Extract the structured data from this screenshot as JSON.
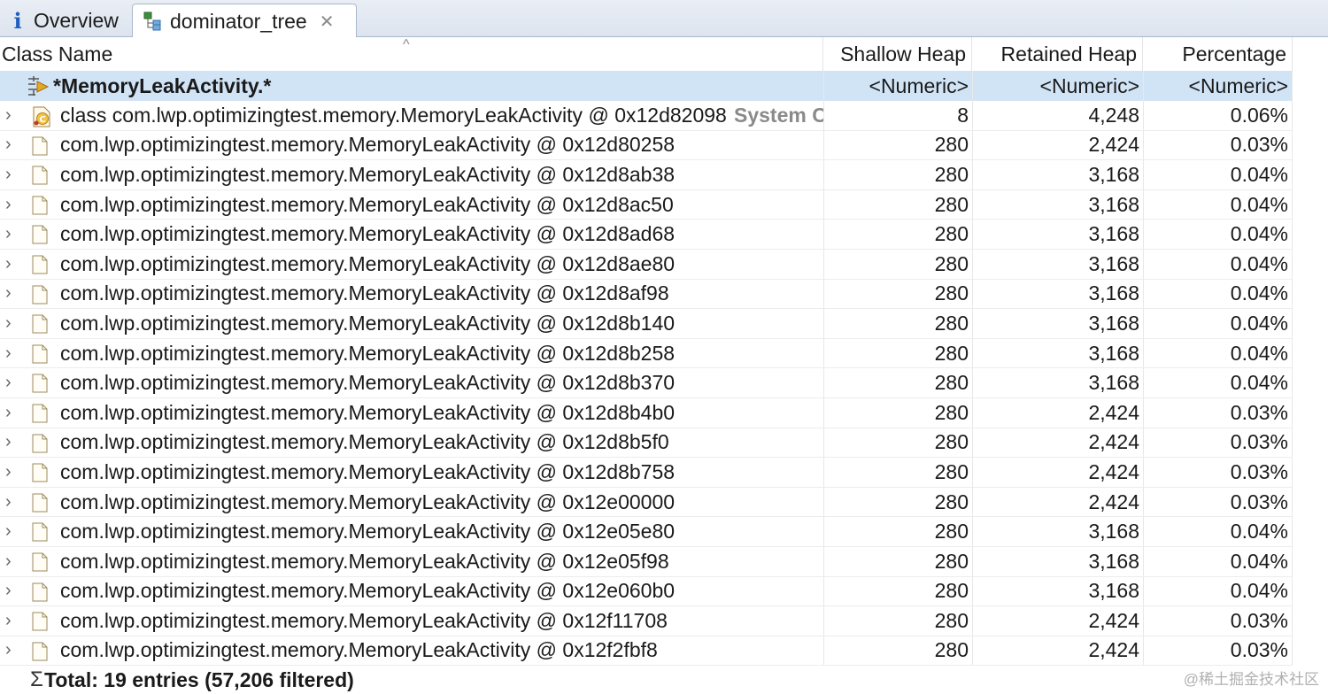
{
  "tabs": [
    {
      "label": "Overview",
      "icon": "info-icon"
    },
    {
      "label": "dominator_tree",
      "icon": "tree-icon",
      "active": true
    }
  ],
  "columns": {
    "name": "Class Name",
    "shallow": "Shallow Heap",
    "retained": "Retained Heap",
    "percentage": "Percentage"
  },
  "filter": {
    "name": "*MemoryLeakActivity.*",
    "shallow": "<Numeric>",
    "retained": "<Numeric>",
    "percentage": "<Numeric>"
  },
  "rows": [
    {
      "name": "class com.lwp.optimizingtest.memory.MemoryLeakActivity @ 0x12d82098",
      "extra": "System Class",
      "shallow": "8",
      "retained": "4,248",
      "pct": "0.06%",
      "icon": "class-icon"
    },
    {
      "name": "com.lwp.optimizingtest.memory.MemoryLeakActivity @ 0x12d80258",
      "shallow": "280",
      "retained": "2,424",
      "pct": "0.03%",
      "icon": "object-icon"
    },
    {
      "name": "com.lwp.optimizingtest.memory.MemoryLeakActivity @ 0x12d8ab38",
      "shallow": "280",
      "retained": "3,168",
      "pct": "0.04%",
      "icon": "object-icon"
    },
    {
      "name": "com.lwp.optimizingtest.memory.MemoryLeakActivity @ 0x12d8ac50",
      "shallow": "280",
      "retained": "3,168",
      "pct": "0.04%",
      "icon": "object-icon"
    },
    {
      "name": "com.lwp.optimizingtest.memory.MemoryLeakActivity @ 0x12d8ad68",
      "shallow": "280",
      "retained": "3,168",
      "pct": "0.04%",
      "icon": "object-icon"
    },
    {
      "name": "com.lwp.optimizingtest.memory.MemoryLeakActivity @ 0x12d8ae80",
      "shallow": "280",
      "retained": "3,168",
      "pct": "0.04%",
      "icon": "object-icon"
    },
    {
      "name": "com.lwp.optimizingtest.memory.MemoryLeakActivity @ 0x12d8af98",
      "shallow": "280",
      "retained": "3,168",
      "pct": "0.04%",
      "icon": "object-icon"
    },
    {
      "name": "com.lwp.optimizingtest.memory.MemoryLeakActivity @ 0x12d8b140",
      "shallow": "280",
      "retained": "3,168",
      "pct": "0.04%",
      "icon": "object-icon"
    },
    {
      "name": "com.lwp.optimizingtest.memory.MemoryLeakActivity @ 0x12d8b258",
      "shallow": "280",
      "retained": "3,168",
      "pct": "0.04%",
      "icon": "object-icon"
    },
    {
      "name": "com.lwp.optimizingtest.memory.MemoryLeakActivity @ 0x12d8b370",
      "shallow": "280",
      "retained": "3,168",
      "pct": "0.04%",
      "icon": "object-icon"
    },
    {
      "name": "com.lwp.optimizingtest.memory.MemoryLeakActivity @ 0x12d8b4b0",
      "shallow": "280",
      "retained": "2,424",
      "pct": "0.03%",
      "icon": "object-icon"
    },
    {
      "name": "com.lwp.optimizingtest.memory.MemoryLeakActivity @ 0x12d8b5f0",
      "shallow": "280",
      "retained": "2,424",
      "pct": "0.03%",
      "icon": "object-icon"
    },
    {
      "name": "com.lwp.optimizingtest.memory.MemoryLeakActivity @ 0x12d8b758",
      "shallow": "280",
      "retained": "2,424",
      "pct": "0.03%",
      "icon": "object-icon"
    },
    {
      "name": "com.lwp.optimizingtest.memory.MemoryLeakActivity @ 0x12e00000",
      "shallow": "280",
      "retained": "2,424",
      "pct": "0.03%",
      "icon": "object-icon"
    },
    {
      "name": "com.lwp.optimizingtest.memory.MemoryLeakActivity @ 0x12e05e80",
      "shallow": "280",
      "retained": "3,168",
      "pct": "0.04%",
      "icon": "object-icon"
    },
    {
      "name": "com.lwp.optimizingtest.memory.MemoryLeakActivity @ 0x12e05f98",
      "shallow": "280",
      "retained": "3,168",
      "pct": "0.04%",
      "icon": "object-icon"
    },
    {
      "name": "com.lwp.optimizingtest.memory.MemoryLeakActivity @ 0x12e060b0",
      "shallow": "280",
      "retained": "3,168",
      "pct": "0.04%",
      "icon": "object-icon"
    },
    {
      "name": "com.lwp.optimizingtest.memory.MemoryLeakActivity @ 0x12f11708",
      "shallow": "280",
      "retained": "2,424",
      "pct": "0.03%",
      "icon": "object-icon"
    },
    {
      "name": "com.lwp.optimizingtest.memory.MemoryLeakActivity @ 0x12f2fbf8",
      "shallow": "280",
      "retained": "2,424",
      "pct": "0.03%",
      "icon": "object-icon"
    }
  ],
  "total": "Total: 19 entries (57,206 filtered)",
  "watermark": "@稀土掘金技术社区",
  "colors": {
    "selection": "#d1e4f6",
    "accent": "#1f5fbf"
  }
}
